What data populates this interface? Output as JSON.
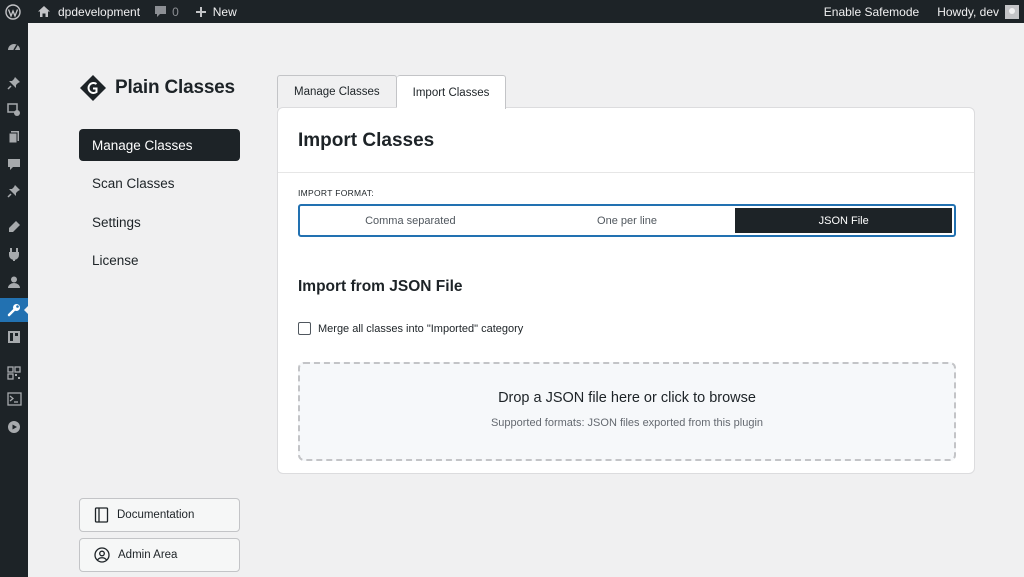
{
  "admin_bar": {
    "site_name": "dpdevelopment",
    "comments_count": "0",
    "new_label": "New",
    "safemode_label": "Enable Safemode",
    "howdy_label": "Howdy, dev"
  },
  "admin_menu": {
    "icons": [
      "dashboard-icon",
      "pin-icon",
      "media-icon",
      "pages-icon",
      "comments-icon",
      "pin-icon",
      "appearance-icon",
      "plugins-icon",
      "users-icon",
      "tools-icon",
      "layout-icon",
      "qr-icon",
      "terminal-icon",
      "play-icon"
    ],
    "active": "tools-icon"
  },
  "plugin": {
    "name": "Plain Classes",
    "nav": [
      {
        "label": "Manage Classes",
        "active": true
      },
      {
        "label": "Scan Classes",
        "active": false
      },
      {
        "label": "Settings",
        "active": false
      },
      {
        "label": "License",
        "active": false
      }
    ],
    "documentation_label": "Documentation",
    "admin_area_label": "Admin Area"
  },
  "tabs": [
    {
      "label": "Manage Classes",
      "active": false
    },
    {
      "label": "Import Classes",
      "active": true
    }
  ],
  "card": {
    "title": "Import Classes",
    "format_label": "IMPORT FORMAT:",
    "format_options": [
      {
        "label": "Comma separated",
        "active": false
      },
      {
        "label": "One per line",
        "active": false
      },
      {
        "label": "JSON File",
        "active": true
      }
    ],
    "section_title": "Import from JSON File",
    "merge_label": "Merge all classes into \"Imported\" category",
    "merge_checked": false,
    "drop_title": "Drop a JSON file here or click to browse",
    "drop_subtitle": "Supported formats: JSON files exported from this plugin"
  },
  "colors": {
    "admin_dark": "#1d2327",
    "accent": "#2271b1",
    "background": "#f0f0f1"
  }
}
